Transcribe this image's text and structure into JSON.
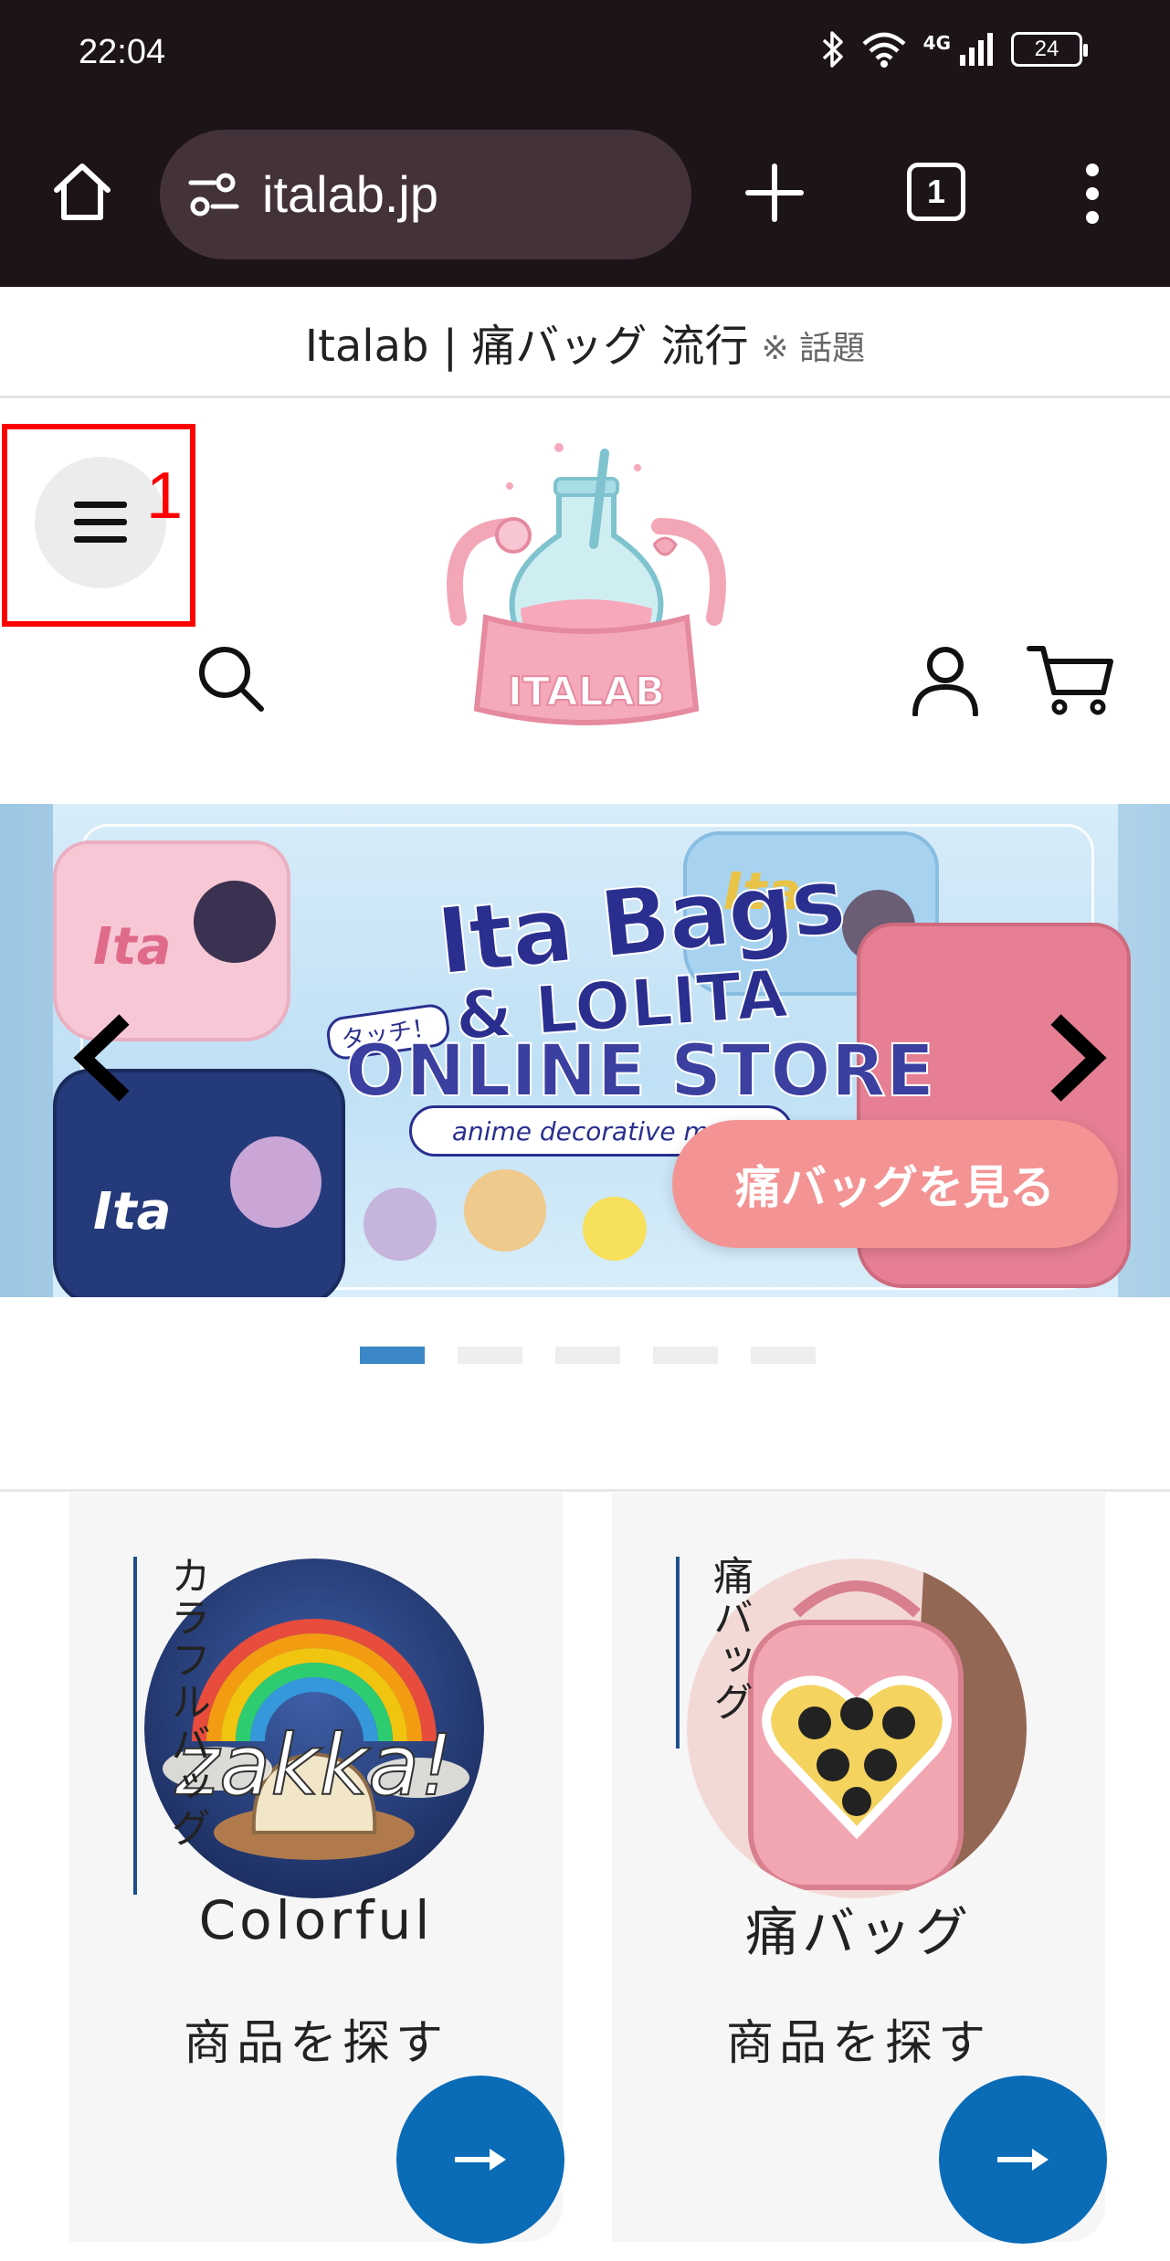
{
  "status_bar": {
    "time": "22:04",
    "network": "4G",
    "battery": "24",
    "icons": [
      "bluetooth-icon",
      "wifi-icon",
      "signal-icon",
      "battery-icon"
    ]
  },
  "browser": {
    "url": "italab.jp",
    "tab_count": "1",
    "icons": [
      "home-icon",
      "site-settings-icon",
      "new-tab-icon",
      "tabs-icon",
      "more-icon"
    ]
  },
  "announcement": {
    "text": "Italab | 痛バッグ 流行",
    "note": "※ 話題"
  },
  "header": {
    "logo_text": "ITALAB",
    "menu_annotation": "1",
    "icons": [
      "hamburger-menu-icon",
      "search-icon",
      "account-icon",
      "cart-icon"
    ]
  },
  "hero": {
    "title_line1": "Ita Bags",
    "title_line2": "& LOLITA",
    "title_line3": "ONLINE STORE",
    "touch_label": "タッチ！",
    "subtitle": "anime decorative mate",
    "bag_labels": [
      "Ita",
      "Ita",
      "Ita"
    ],
    "cta": "痛バッグを見る",
    "slide_count": 5,
    "active_slide": 1
  },
  "categories": [
    {
      "vertical_label": "カラフルバッグ",
      "badge_text": "zakka!",
      "title": "Colorful",
      "subtitle": "商品を探す"
    },
    {
      "vertical_label": "痛バッグ",
      "badge_text": "",
      "title": "痛バッグ",
      "subtitle": "商品を探す"
    }
  ],
  "colors": {
    "browser_bg": "#1c1418",
    "url_bg": "#44323b",
    "accent_blue": "#0a6bb7",
    "cta_pink": "#f49393",
    "dot_active": "#3b87c7",
    "annotation_red": "#ff0000"
  }
}
